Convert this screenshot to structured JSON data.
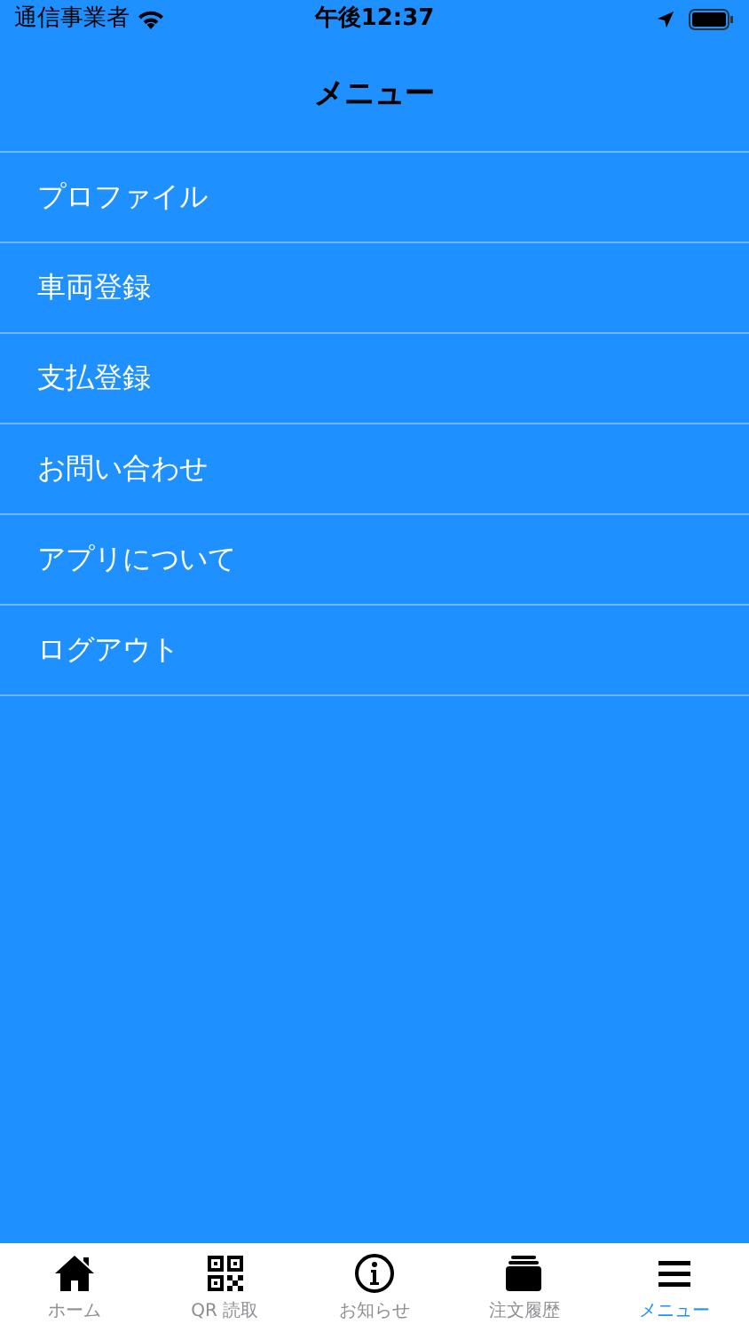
{
  "status_bar": {
    "carrier": "通信事業者",
    "time": "午後12:37"
  },
  "nav_bar": {
    "title": "メニュー"
  },
  "menu_items": [
    {
      "label": "プロファイル"
    },
    {
      "label": "車両登録"
    },
    {
      "label": "支払登録"
    },
    {
      "label": "お問い合わせ"
    },
    {
      "label": "アプリについて"
    },
    {
      "label": "ログアウト"
    }
  ],
  "tab_bar": [
    {
      "kind": "home",
      "label": "ホーム",
      "selected": false
    },
    {
      "kind": "qr",
      "label": "QR 読取",
      "selected": false
    },
    {
      "kind": "info",
      "label": "お知らせ",
      "selected": false
    },
    {
      "kind": "tray",
      "label": "注文履歴",
      "selected": false
    },
    {
      "kind": "menu",
      "label": "メニュー",
      "selected": true
    }
  ]
}
